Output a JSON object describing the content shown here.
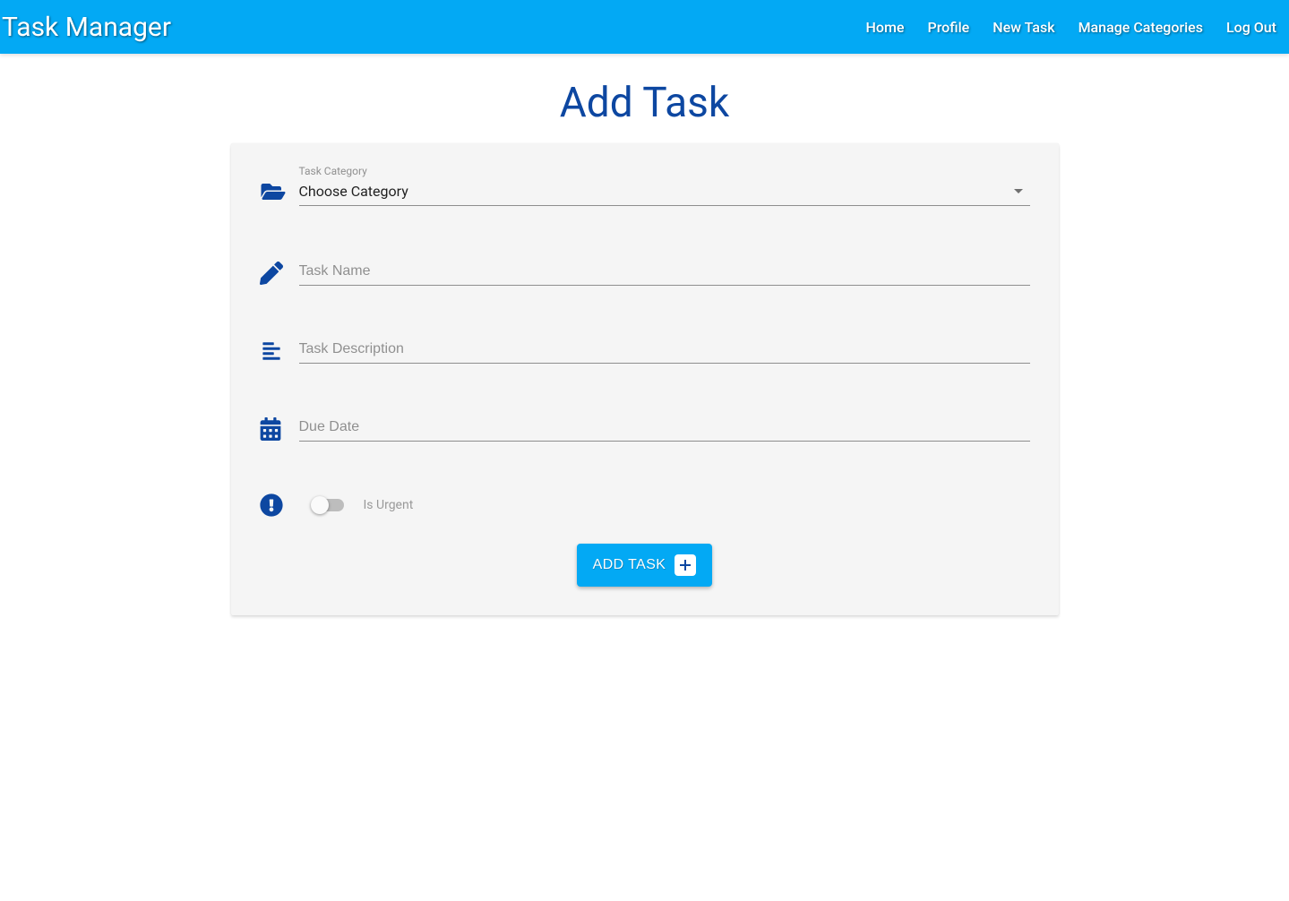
{
  "header": {
    "brand": "Task Manager",
    "nav": {
      "home": "Home",
      "profile": "Profile",
      "new_task": "New Task",
      "manage_categories": "Manage Categories",
      "log_out": "Log Out"
    }
  },
  "page": {
    "title": "Add Task"
  },
  "form": {
    "category": {
      "label": "Task Category",
      "value": "Choose Category"
    },
    "task_name": {
      "placeholder": "Task Name",
      "value": ""
    },
    "task_description": {
      "placeholder": "Task Description",
      "value": ""
    },
    "due_date": {
      "placeholder": "Due Date",
      "value": ""
    },
    "is_urgent": {
      "label": "Is Urgent",
      "checked": false
    },
    "submit_label": "ADD TASK"
  }
}
